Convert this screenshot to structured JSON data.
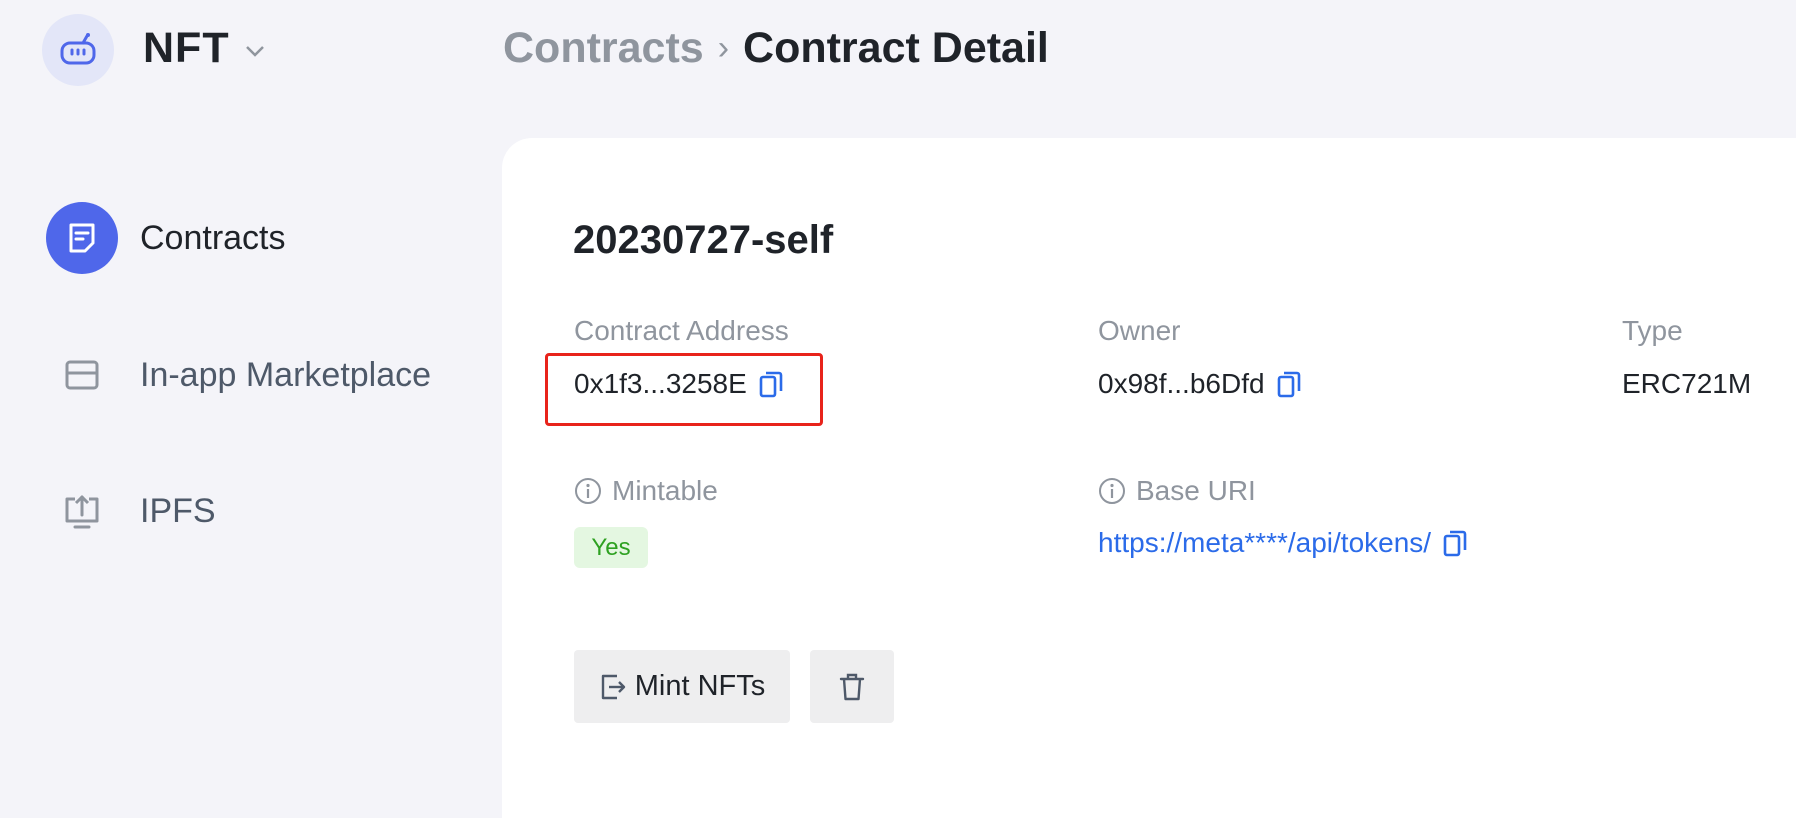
{
  "header": {
    "app_name": "NFT",
    "breadcrumb": {
      "parent": "Contracts",
      "separator": "›",
      "current": "Contract Detail"
    }
  },
  "sidebar": {
    "items": [
      {
        "label": "Contracts",
        "icon": "document-icon",
        "active": true
      },
      {
        "label": "In-app Marketplace",
        "icon": "store-icon",
        "active": false
      },
      {
        "label": "IPFS",
        "icon": "upload-icon",
        "active": false
      }
    ]
  },
  "contract": {
    "name": "20230727-self",
    "fields": {
      "contract_address": {
        "label": "Contract Address",
        "value": "0x1f3...3258E"
      },
      "owner": {
        "label": "Owner",
        "value": "0x98f...b6Dfd"
      },
      "type": {
        "label": "Type",
        "value": "ERC721M"
      },
      "mintable": {
        "label": "Mintable",
        "value": "Yes"
      },
      "base_uri": {
        "label": "Base URI",
        "value": "https://meta****/api/tokens/"
      }
    }
  },
  "actions": {
    "mint_label": "Mint NFTs",
    "delete_icon": "trash-icon"
  },
  "colors": {
    "accent": "#4f67ea",
    "link": "#2b6be9",
    "highlight": "#e8231b",
    "badge_bg": "#e4f7e1",
    "badge_text": "#2ea121"
  }
}
